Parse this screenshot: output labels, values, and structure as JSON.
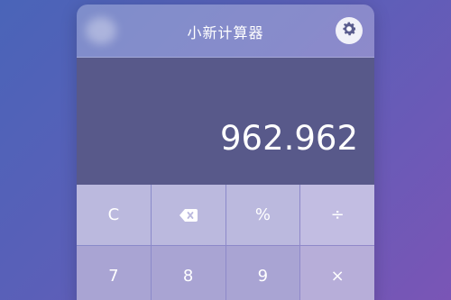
{
  "app": {
    "title": "小新计算器"
  },
  "display": {
    "value": "962.962"
  },
  "keys": [
    {
      "label": "C",
      "name": "clear-button"
    },
    {
      "label": "",
      "name": "backspace-button",
      "icon": "backspace-icon"
    },
    {
      "label": "%",
      "name": "percent-button"
    },
    {
      "label": "÷",
      "name": "divide-button"
    },
    {
      "label": "7",
      "name": "digit-7-button"
    },
    {
      "label": "8",
      "name": "digit-8-button"
    },
    {
      "label": "9",
      "name": "digit-9-button"
    },
    {
      "label": "×",
      "name": "multiply-button"
    }
  ],
  "colors": {
    "display_bg": "#58598a",
    "key_bg": "#b6b4dc",
    "text": "#ffffff"
  },
  "icons": {
    "settings": "gear-icon",
    "backspace": "backspace-icon"
  }
}
